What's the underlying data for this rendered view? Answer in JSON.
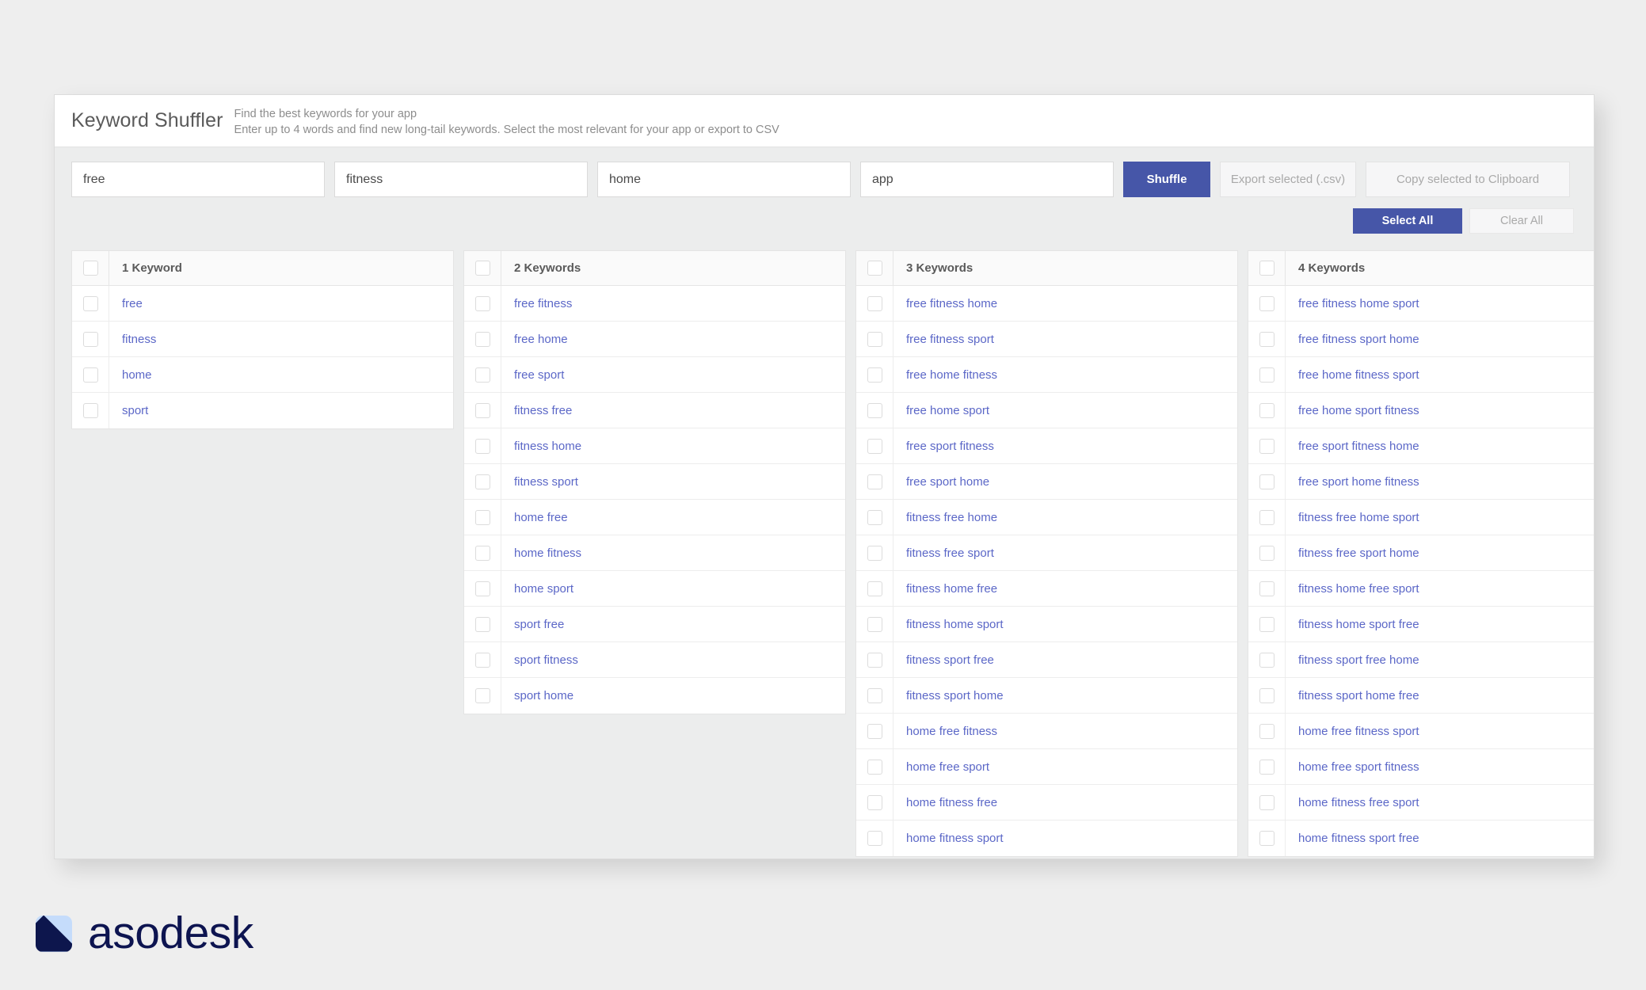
{
  "app": {
    "title": "Keyword Shuffler",
    "subtitle_line1": "Find the best keywords for your app",
    "subtitle_line2": "Enter up to 4 words and find new long-tail keywords. Select the most relevant for your app or export to CSV"
  },
  "colors": {
    "accent": "#4656a8",
    "link": "#5b67c7",
    "muted_button_bg": "#f6f6f7",
    "muted_button_text": "#a9a9a9",
    "page_background": "#eeeeee",
    "logo_navy": "#0d1450",
    "logo_light_blue": "#c5dcfb"
  },
  "inputs": [
    {
      "name": "word-1",
      "value": "free",
      "placeholder": ""
    },
    {
      "name": "word-2",
      "value": "fitness",
      "placeholder": ""
    },
    {
      "name": "word-3",
      "value": "home",
      "placeholder": ""
    },
    {
      "name": "word-4",
      "value": "app",
      "placeholder": ""
    }
  ],
  "toolbar": {
    "shuffle_label": "Shuffle",
    "export_label": "Export selected (.csv)",
    "copy_label": "Copy selected to Clipboard",
    "select_all_label": "Select All",
    "clear_all_label": "Clear All"
  },
  "columns": [
    {
      "header": "1 Keyword",
      "keywords": [
        "free",
        "fitness",
        "home",
        "sport"
      ]
    },
    {
      "header": "2 Keywords",
      "keywords": [
        "free fitness",
        "free home",
        "free sport",
        "fitness free",
        "fitness home",
        "fitness sport",
        "home free",
        "home fitness",
        "home sport",
        "sport free",
        "sport fitness",
        "sport home"
      ]
    },
    {
      "header": "3 Keywords",
      "keywords": [
        "free fitness home",
        "free fitness sport",
        "free home fitness",
        "free home sport",
        "free sport fitness",
        "free sport home",
        "fitness free home",
        "fitness free sport",
        "fitness home free",
        "fitness home sport",
        "fitness sport free",
        "fitness sport home",
        "home free fitness",
        "home free sport",
        "home fitness free",
        "home fitness sport"
      ]
    },
    {
      "header": "4 Keywords",
      "keywords": [
        "free fitness home sport",
        "free fitness sport home",
        "free home fitness sport",
        "free home sport fitness",
        "free sport fitness home",
        "free sport home fitness",
        "fitness free home sport",
        "fitness free sport home",
        "fitness home free sport",
        "fitness home sport free",
        "fitness sport free home",
        "fitness sport home free",
        "home free fitness sport",
        "home free sport fitness",
        "home fitness free sport",
        "home fitness sport free"
      ]
    }
  ],
  "footer": {
    "logo_text": "asodesk"
  }
}
